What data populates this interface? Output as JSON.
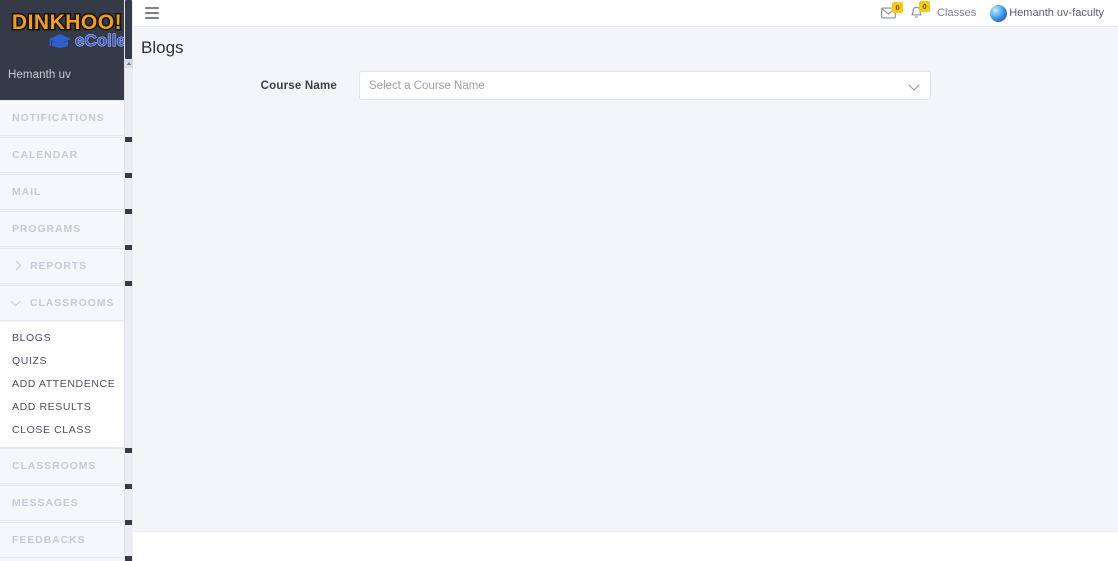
{
  "brand": {
    "logo_primary": "DINKHOO!",
    "logo_secondary": "eCollege",
    "logo_icon": "graduation-cap-icon",
    "logo_primary_color": "#f59c1a",
    "logo_secondary_color": "#3b5bd4"
  },
  "sidebar": {
    "user_name": "Hemanth uv",
    "items": [
      {
        "label": "NOTIFICATIONS",
        "chevron": "none"
      },
      {
        "label": "CALENDAR",
        "chevron": "none"
      },
      {
        "label": "MAIL",
        "chevron": "none"
      },
      {
        "label": "PROGRAMS",
        "chevron": "none"
      },
      {
        "label": "REPORTS",
        "chevron": "right"
      },
      {
        "label": "CLASSROOMS",
        "chevron": "down"
      }
    ],
    "sub_items": [
      {
        "label": "BLOGS"
      },
      {
        "label": "QUIZS"
      },
      {
        "label": "ADD ATTENDENCE"
      },
      {
        "label": "ADD RESULTS"
      },
      {
        "label": "CLOSE CLASS"
      }
    ],
    "items_after": [
      {
        "label": "CLASSROOMS",
        "chevron": "none"
      },
      {
        "label": "MESSAGES",
        "chevron": "none"
      },
      {
        "label": "FEEDBACKS",
        "chevron": "none"
      }
    ]
  },
  "topbar": {
    "menu_icon": "hamburger-icon",
    "mail_icon": "envelope-icon",
    "mail_badge": "0",
    "bell_icon": "bell-icon",
    "bell_badge": "0",
    "classes_link": "Classes",
    "avatar_icon": "user-avatar",
    "user_label": "Hemanth uv-faculty",
    "badge_color": "#f7c815"
  },
  "main": {
    "title": "Blogs",
    "form": {
      "course_label": "Course Name",
      "course_placeholder": "Select a Course Name",
      "course_value": "",
      "dropdown_icon": "chevron-down-icon"
    }
  }
}
